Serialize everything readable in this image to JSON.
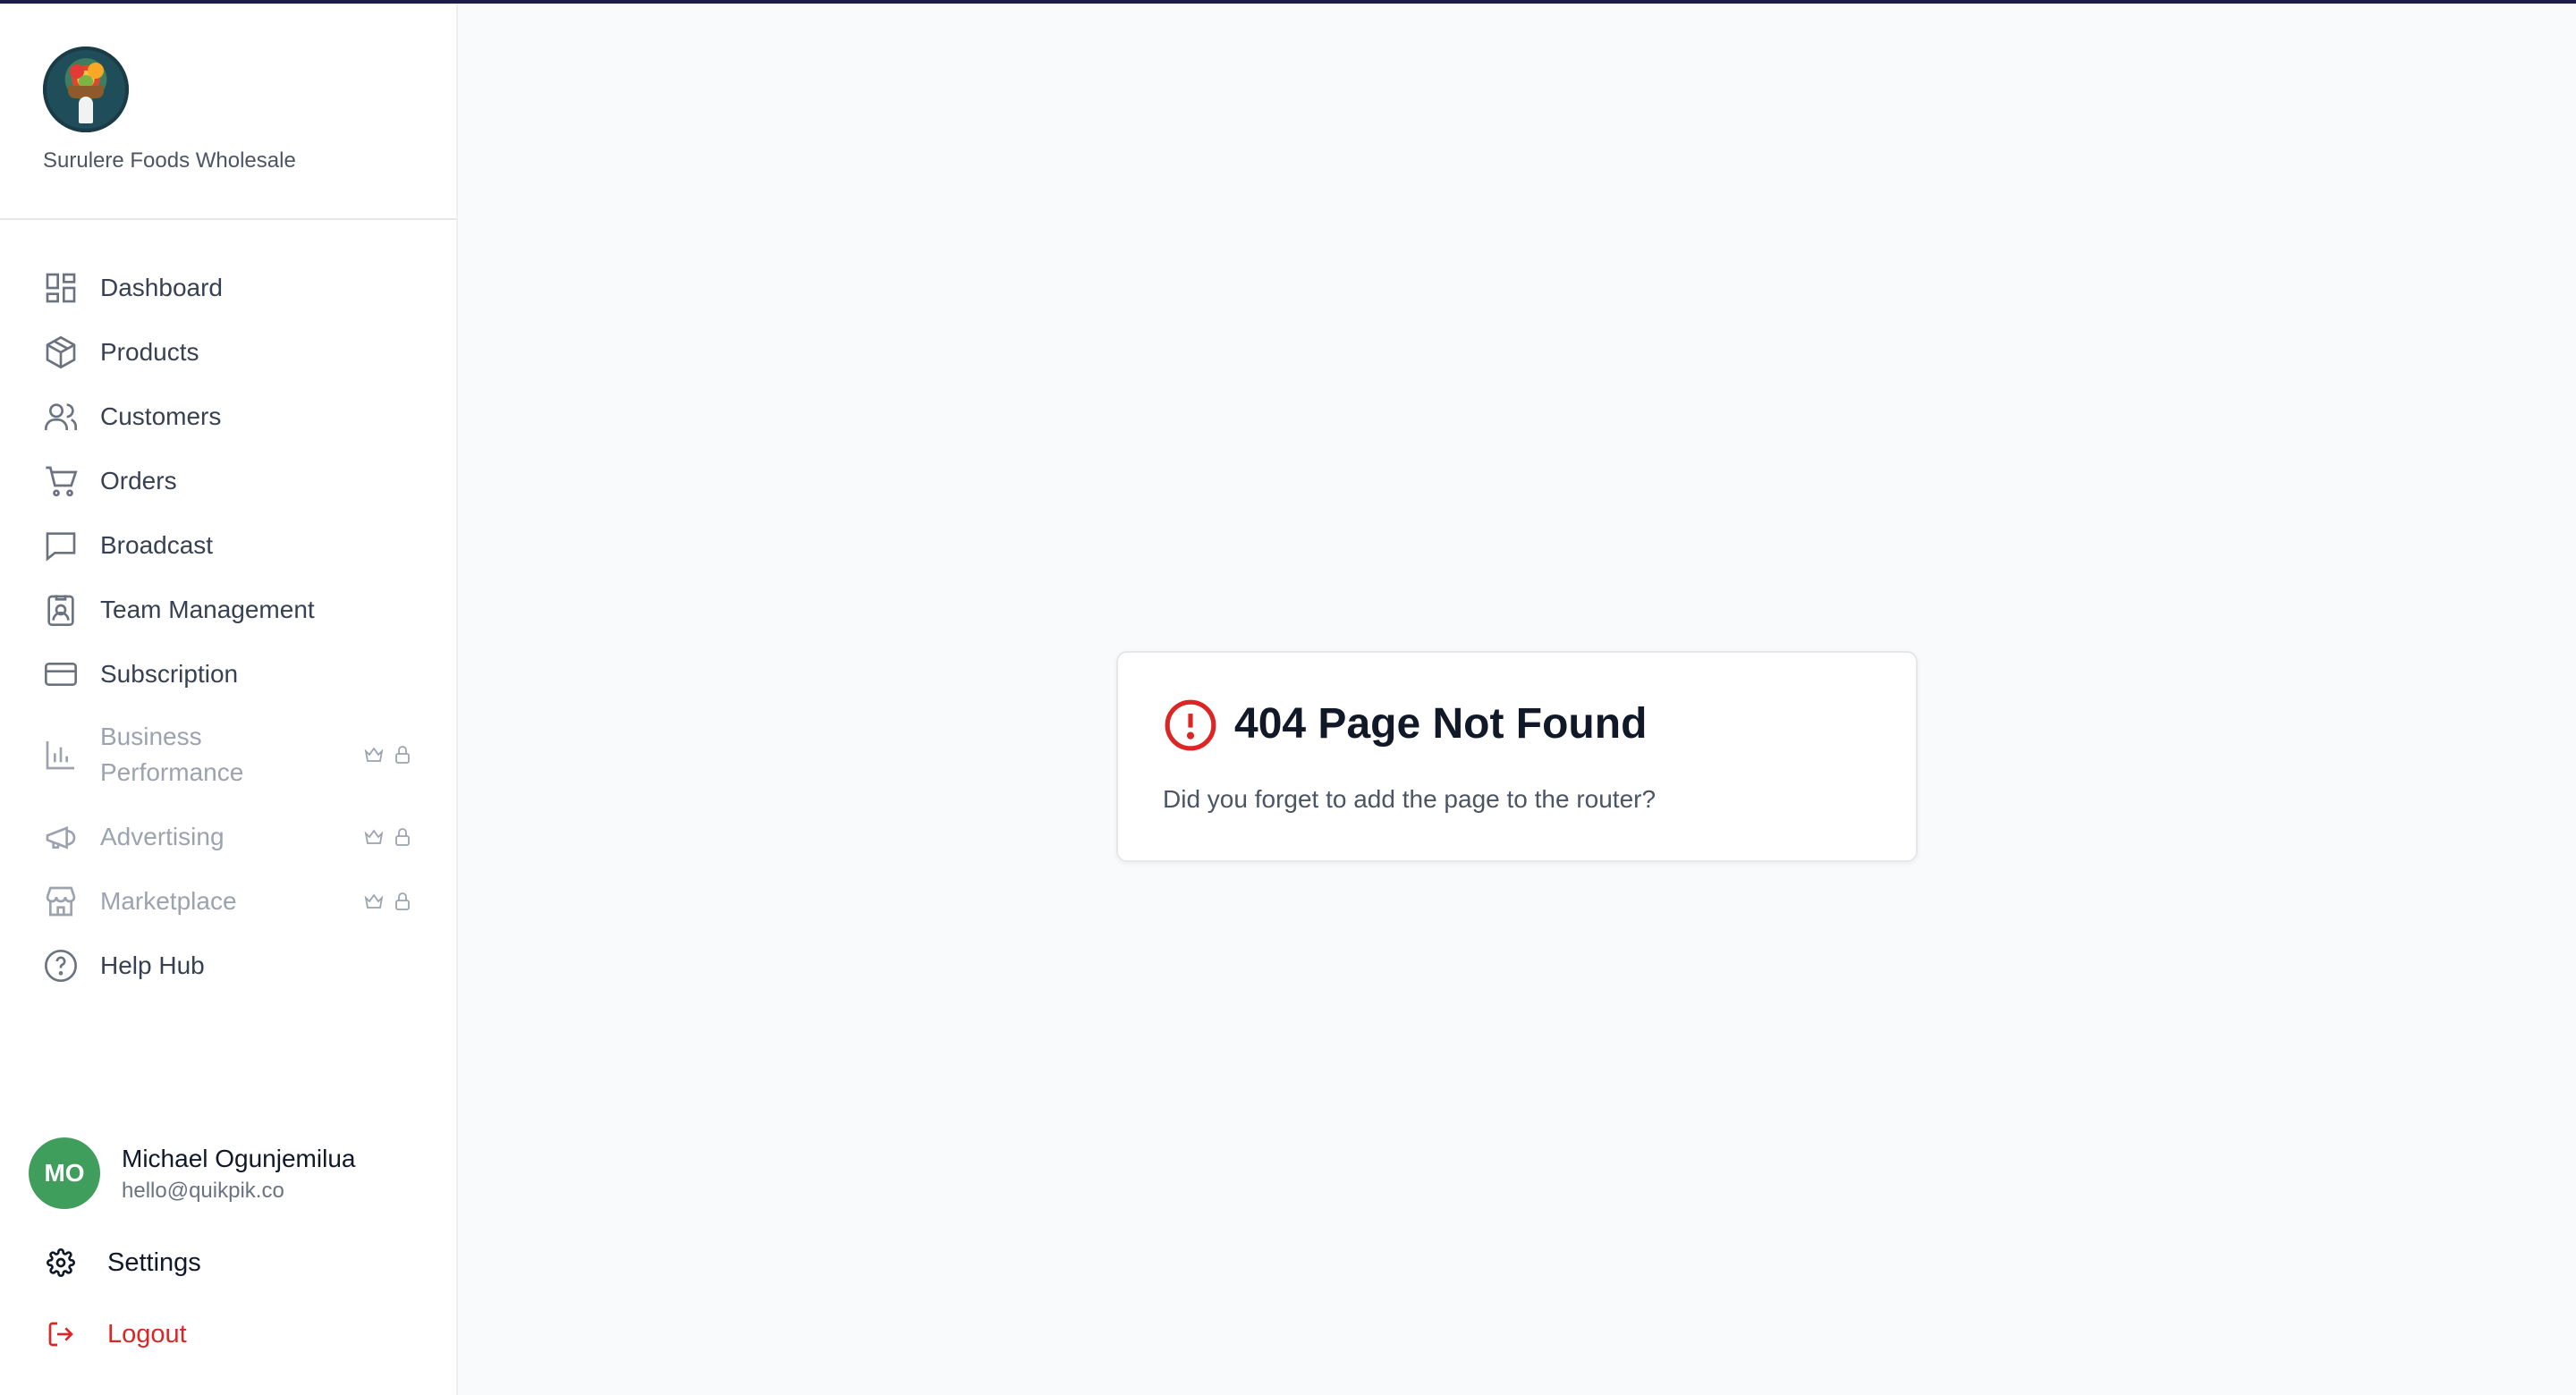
{
  "brand": {
    "name": "Surulere Foods Wholesale",
    "logo_icon": "store-logo"
  },
  "nav": {
    "items": [
      {
        "label": "Dashboard",
        "icon": "dashboard-icon"
      },
      {
        "label": "Products",
        "icon": "box-icon"
      },
      {
        "label": "Customers",
        "icon": "users-icon"
      },
      {
        "label": "Orders",
        "icon": "cart-icon"
      },
      {
        "label": "Broadcast",
        "icon": "message-icon"
      },
      {
        "label": "Team Management",
        "icon": "id-badge-icon"
      },
      {
        "label": "Subscription",
        "icon": "credit-card-icon"
      },
      {
        "label": "Business Performance",
        "label_line1": "Business",
        "label_line2": "Performance",
        "icon": "bar-chart-icon",
        "locked": true
      },
      {
        "label": "Advertising",
        "icon": "megaphone-icon",
        "locked": true
      },
      {
        "label": "Marketplace",
        "icon": "storefront-icon",
        "locked": true
      },
      {
        "label": "Help Hub",
        "icon": "help-circle-icon"
      }
    ]
  },
  "user": {
    "initials": "MO",
    "name": "Michael Ogunjemilua",
    "email": "hello@quikpik.co",
    "avatar_color": "#3f9e5c"
  },
  "footer": {
    "settings_label": "Settings",
    "logout_label": "Logout"
  },
  "error": {
    "title": "404 Page Not Found",
    "message": "Did you forget to add the page to the router?",
    "accent_color": "#dc2626"
  }
}
